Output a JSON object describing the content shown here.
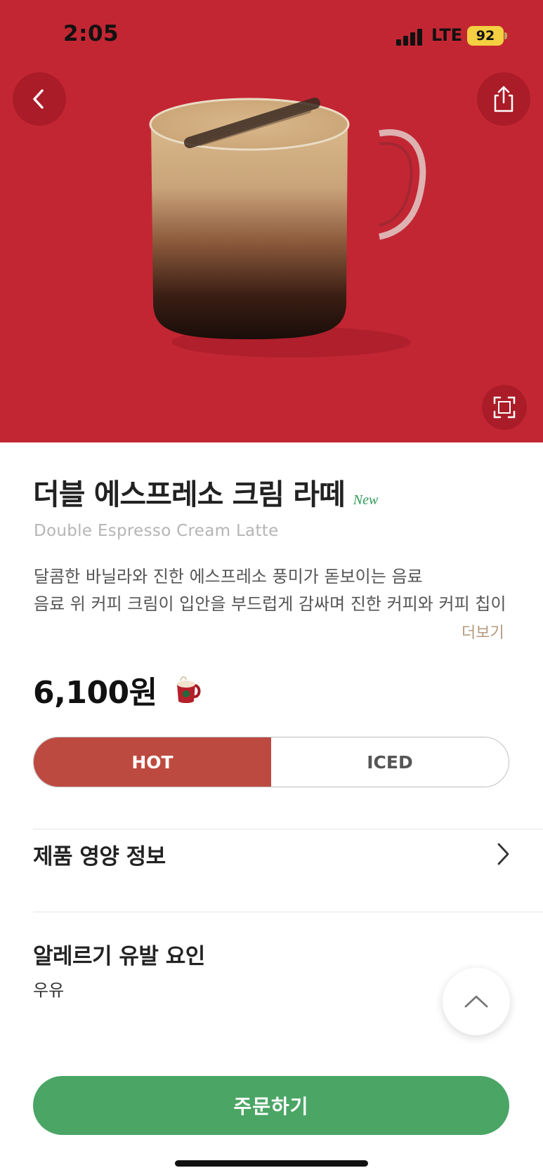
{
  "status_bar": {
    "time": "2:05",
    "network": "LTE",
    "battery": "92"
  },
  "hero": {
    "background_color": "#c32633",
    "icons": [
      "back-icon",
      "share-icon",
      "zoom-frame-icon"
    ]
  },
  "product": {
    "name_ko": "더블 에스프레소 크림 라떼",
    "new_tag": "New",
    "name_en": "Double Espresso Cream Latte",
    "description": "달콤한 바닐라와 진한 에스프레소 풍미가 돋보이는 음료\n음료 위 커피 크림이 입안을 부드럽게 감싸며 진한 커피와 커피 칩이",
    "more_label": "더보기",
    "price": "6,100원"
  },
  "temperature": {
    "options": [
      "HOT",
      "ICED"
    ],
    "selected": "HOT"
  },
  "nutrition": {
    "label": "제품 영양 정보"
  },
  "allergy": {
    "label": "알레르기 유발 요인",
    "value": "우유"
  },
  "order": {
    "label": "주문하기",
    "color": "#4ba565"
  },
  "colors": {
    "hot_selected": "#bd4a40",
    "new_tag": "#2f9a56",
    "more_link": "#b59b7c"
  }
}
